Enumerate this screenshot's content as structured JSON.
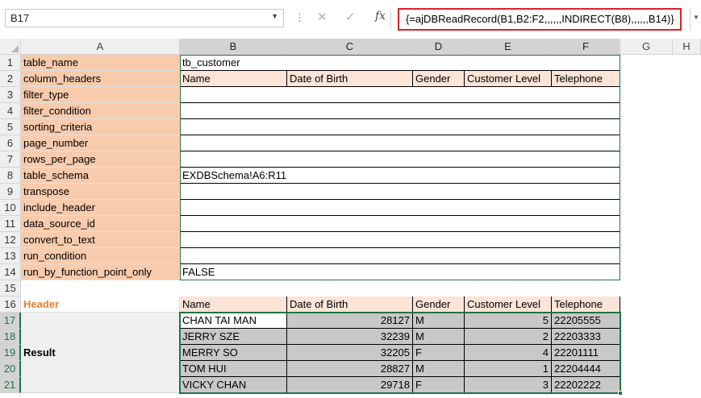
{
  "formula_bar": {
    "name_box": "B17",
    "formula": "{=ajDBReadRecord(B1,B2:F2,,,,,,INDIRECT(B8),,,,,,B14)}",
    "fx_label": "fx"
  },
  "columns": [
    "A",
    "B",
    "C",
    "D",
    "E",
    "F",
    "G",
    "H"
  ],
  "rows": [
    "1",
    "2",
    "3",
    "4",
    "5",
    "6",
    "7",
    "8",
    "9",
    "10",
    "11",
    "12",
    "13",
    "14",
    "15",
    "16",
    "17",
    "18",
    "19",
    "20",
    "21"
  ],
  "params": [
    {
      "name": "table_name",
      "value": "tb_customer"
    },
    {
      "name": "column_headers",
      "value": ""
    },
    {
      "name": "filter_type",
      "value": ""
    },
    {
      "name": "filter_condition",
      "value": ""
    },
    {
      "name": "sorting_criteria",
      "value": ""
    },
    {
      "name": "page_number",
      "value": ""
    },
    {
      "name": "rows_per_page",
      "value": ""
    },
    {
      "name": "table_schema",
      "value": "EXDBSchema!A6:R11"
    },
    {
      "name": "transpose",
      "value": ""
    },
    {
      "name": "include_header",
      "value": ""
    },
    {
      "name": "data_source_id",
      "value": ""
    },
    {
      "name": "convert_to_text",
      "value": ""
    },
    {
      "name": "run_condition",
      "value": ""
    },
    {
      "name": "run_by_function_point_only",
      "value": "FALSE"
    }
  ],
  "column_headers": [
    "Name",
    "Date of Birth",
    "Gender",
    "Customer Level",
    "Telephone"
  ],
  "header_label": "Header",
  "result_label": "Result",
  "result_rows": [
    {
      "name": "CHAN TAI MAN",
      "dob": "28127",
      "gender": "M",
      "level": "5",
      "tel": "22205555"
    },
    {
      "name": "JERRY SZE",
      "dob": "32239",
      "gender": "M",
      "level": "2",
      "tel": "22203333"
    },
    {
      "name": "MERRY SO",
      "dob": "32205",
      "gender": "F",
      "level": "4",
      "tel": "22201111"
    },
    {
      "name": "TOM HUI",
      "dob": "28827",
      "gender": "M",
      "level": "1",
      "tel": "22204444"
    },
    {
      "name": "VICKY CHAN",
      "dob": "29718",
      "gender": "F",
      "level": "3",
      "tel": "22202222"
    }
  ],
  "colors": {
    "param_fill": "#f8cbad",
    "header_fill": "#fce4d6",
    "result_fill": "#c8c8c8",
    "header_text": "#ed7d31",
    "selection": "#217346",
    "formula_highlight": "#d8212a"
  }
}
